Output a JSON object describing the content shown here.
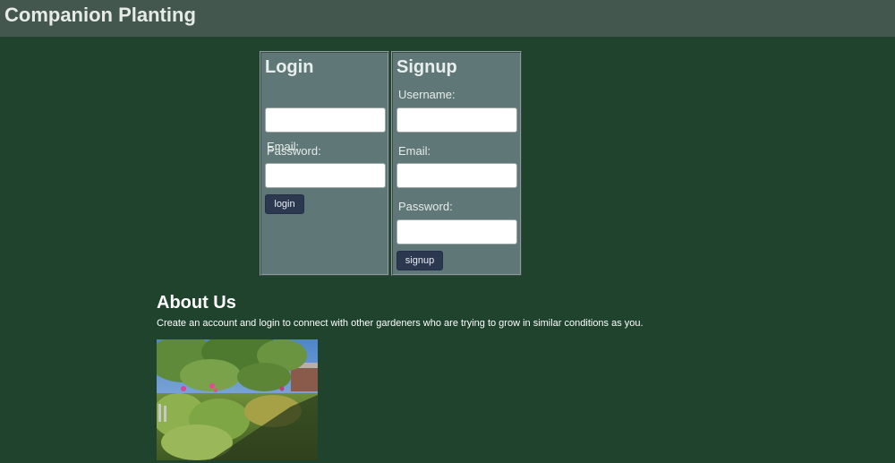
{
  "header": {
    "title": "Companion Planting"
  },
  "login": {
    "title": "Login",
    "email_label": "Email:",
    "email_value": "",
    "password_label": "Password:",
    "password_value": "",
    "button_label": "login"
  },
  "signup": {
    "title": "Signup",
    "username_label": "Username:",
    "username_value": "",
    "email_label": "Email:",
    "email_value": "",
    "password_label": "Password:",
    "password_value": "",
    "button_label": "signup"
  },
  "about": {
    "title": "About Us",
    "text": "Create an account and login to connect with other gardeners who are trying to grow in similar conditions as you."
  },
  "colors": {
    "page_background": "#1f432c",
    "header_background": "#44574f",
    "panel_background": "#5f7776",
    "button_background": "#2b3850"
  }
}
